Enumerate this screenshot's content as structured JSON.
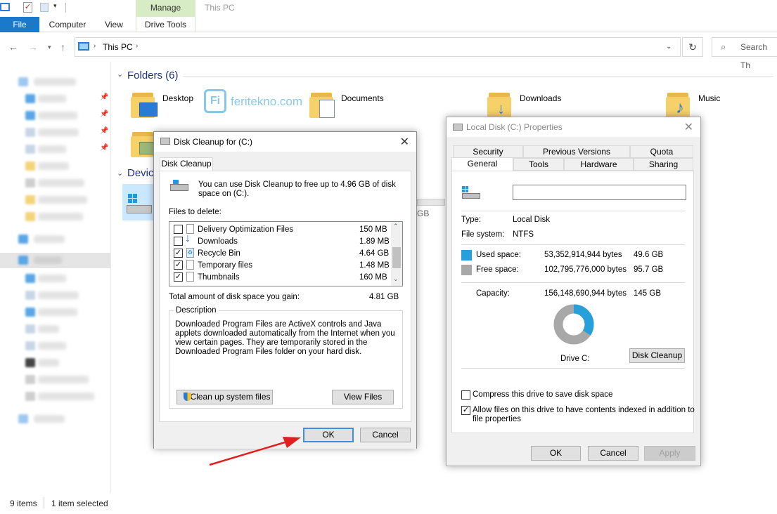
{
  "ribbon": {
    "tabs": [
      "File",
      "Computer",
      "View",
      "Drive Tools"
    ],
    "manage_label": "Manage",
    "window_title": "This PC"
  },
  "address": {
    "path": "This PC",
    "search_placeholder": "Search Th"
  },
  "main": {
    "folders_title": "Folders (6)",
    "folders": [
      "Desktop",
      "Documents",
      "Downloads",
      "Music"
    ],
    "devices_title": "Devic",
    "partial_size": "GB",
    "watermark": "feritekno.com"
  },
  "status": {
    "items": "9 items",
    "selected": "1 item selected"
  },
  "cleanup": {
    "title": "Disk Cleanup for  (C:)",
    "tab": "Disk Cleanup",
    "intro": "You can use Disk Cleanup to free up to 4.96 GB of disk space on  (C:).",
    "files_label": "Files to delete:",
    "files": [
      {
        "name": "Delivery Optimization Files",
        "size": "150 MB",
        "checked": false
      },
      {
        "name": "Downloads",
        "size": "1.89 MB",
        "checked": false
      },
      {
        "name": "Recycle Bin",
        "size": "4.64 GB",
        "checked": true
      },
      {
        "name": "Temporary files",
        "size": "1.48 MB",
        "checked": true
      },
      {
        "name": "Thumbnails",
        "size": "160 MB",
        "checked": true
      }
    ],
    "total_label": "Total amount of disk space you gain:",
    "total_value": "4.81 GB",
    "description_label": "Description",
    "description": "Downloaded Program Files are ActiveX controls and Java applets downloaded automatically from the Internet when you view certain pages. They are temporarily stored in the Downloaded Program Files folder on your hard disk.",
    "clean_system_button": "Clean up system files",
    "view_files_button": "View Files",
    "ok_button": "OK",
    "cancel_button": "Cancel"
  },
  "props": {
    "title": "Local Disk (C:) Properties",
    "tabs_row1": [
      "Security",
      "Previous Versions",
      "Quota"
    ],
    "tabs_row2": [
      "General",
      "Tools",
      "Hardware",
      "Sharing"
    ],
    "name_value": "",
    "type_label": "Type:",
    "type_value": "Local Disk",
    "fs_label": "File system:",
    "fs_value": "NTFS",
    "used_label": "Used space:",
    "used_bytes": "53,352,914,944 bytes",
    "used_gb": "49.6 GB",
    "free_label": "Free space:",
    "free_bytes": "102,795,776,000 bytes",
    "free_gb": "95.7 GB",
    "capacity_label": "Capacity:",
    "capacity_bytes": "156,148,690,944 bytes",
    "capacity_gb": "145 GB",
    "drive_label": "Drive C:",
    "disk_cleanup_button": "Disk Cleanup",
    "compress_label": "Compress this drive to save disk space",
    "compress_checked": false,
    "index_label_1": "Allow files on this drive to have contents indexed in addition to",
    "index_label_2": "file properties",
    "index_checked": true,
    "ok_button": "OK",
    "cancel_button": "Cancel",
    "apply_button": "Apply",
    "used_fraction": 0.3417,
    "used_color": "#26a0da",
    "free_color": "#a8a8a8"
  }
}
